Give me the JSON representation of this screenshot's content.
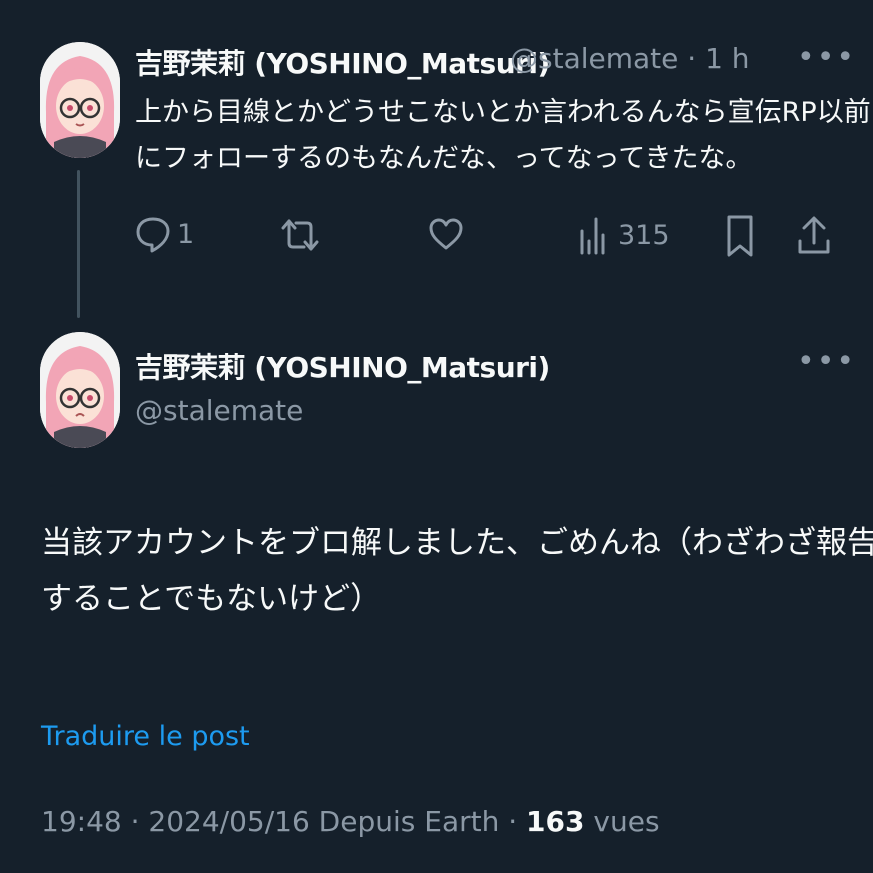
{
  "reply_tweet": {
    "display_name": "吉野茉莉 (YOSHINO_Matsuri)",
    "handle": "@stalemate",
    "separator": "·",
    "time": "1 h",
    "more_label": "•••",
    "text_lines": [
      "上から目線とかどうせこないとか言われるんなら宣伝RP以前",
      "にフォローするのもなんだな、ってなってきたな。"
    ],
    "actions": {
      "reply_count": "1",
      "retweet_count": "",
      "like_count": "",
      "views_count": "315"
    },
    "icons": [
      "reply-icon",
      "retweet-icon",
      "like-icon",
      "views-icon",
      "bookmark-icon",
      "share-icon"
    ]
  },
  "main_tweet": {
    "display_name": "吉野茉莉 (YOSHINO_Matsuri)",
    "handle": "@stalemate",
    "more_label": "•••",
    "text_lines": [
      "当該アカウントをブロ解しました、ごめんね（わざわざ報告",
      "することでもないけど）"
    ],
    "translate_label": "Traduire le post",
    "timestamp": "19:48 · 2024/05/16 Depuis Earth · ",
    "views_count": "163",
    "views_label": " vues"
  },
  "colors": {
    "background": "#15202b",
    "text_primary": "#f7f9f9",
    "text_secondary": "#8b98a5",
    "accent": "#1d9bf0",
    "thread_line": "#42535f"
  }
}
